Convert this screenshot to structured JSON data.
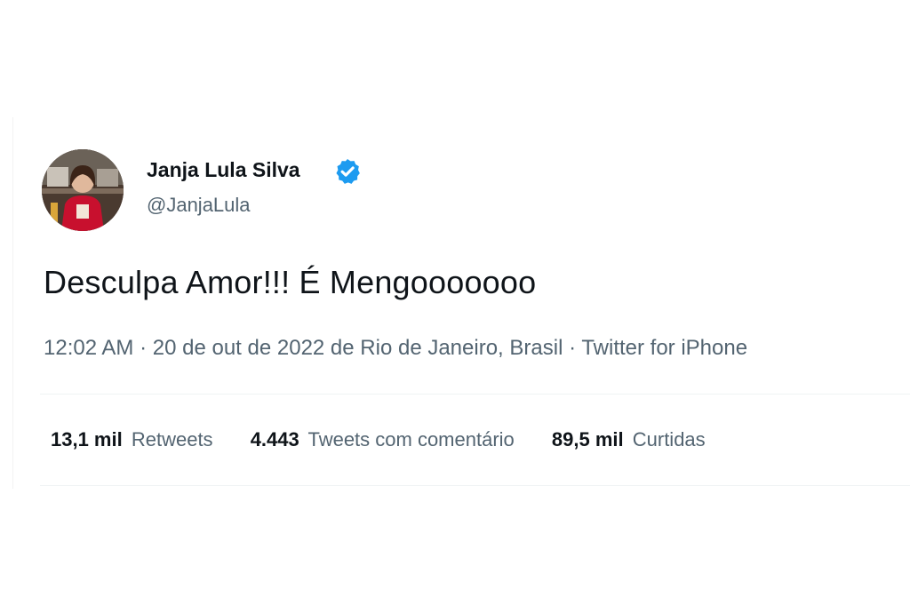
{
  "tweet": {
    "author": {
      "display_name": "Janja Lula Silva",
      "handle": "@JanjaLula",
      "verified": true,
      "verified_color": "#1d9bf0"
    },
    "text": "Desculpa Amor!!! É Mengooooooo",
    "meta": {
      "time": "12:02 AM",
      "separator": "·",
      "date_location": "20 de out de 2022 de Rio de Janeiro, Brasil",
      "source": "Twitter for iPhone"
    },
    "stats": [
      {
        "count": "13,1 mil",
        "label": "Retweets"
      },
      {
        "count": "4.443",
        "label": "Tweets com comentário"
      },
      {
        "count": "89,5 mil",
        "label": "Curtidas"
      }
    ]
  },
  "icons": {
    "avatar": "profile-photo",
    "badge": "verified-badge-icon"
  },
  "colors": {
    "primary_text": "#0f1419",
    "secondary_text": "#536471",
    "accent": "#1d9bf0",
    "divider": "#eff3f4"
  }
}
